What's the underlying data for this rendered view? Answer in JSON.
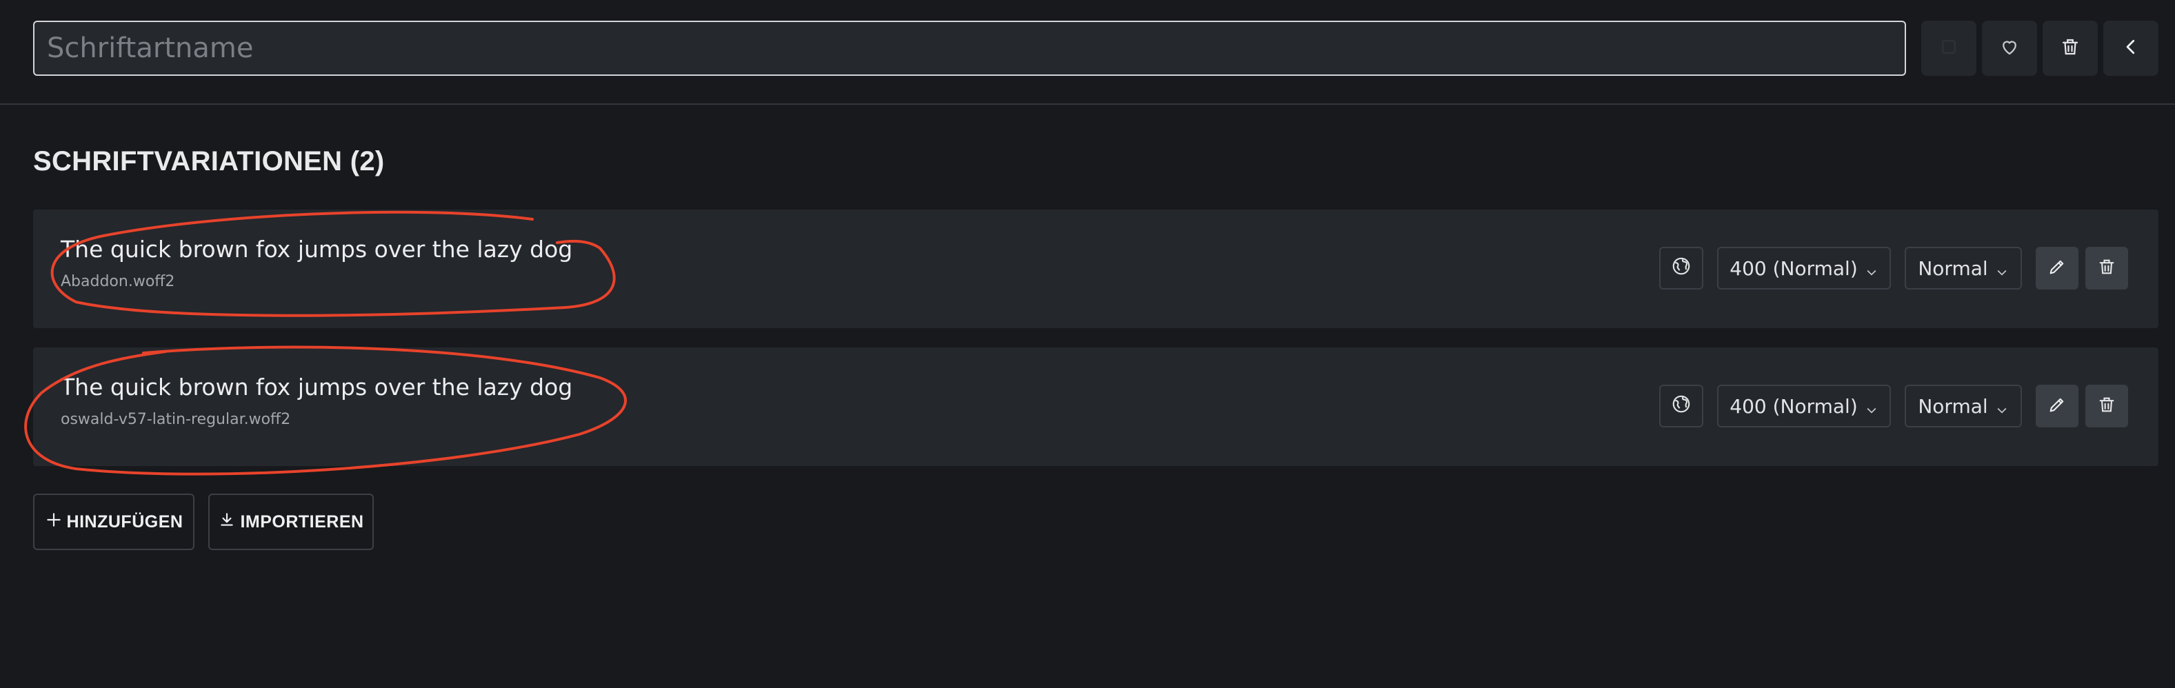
{
  "header": {
    "font_name_placeholder": "Schriftartname",
    "font_name_value": "",
    "icons": [
      "square-icon",
      "heart-icon",
      "trash-icon",
      "chevron-left-icon"
    ]
  },
  "variations": {
    "title": "SCHRIFTVARIATIONEN (2)",
    "items": [
      {
        "sample": "The quick brown fox jumps over the lazy dog",
        "filename": "Abaddon.woff2",
        "weight": "400 (Normal)",
        "style": "Normal"
      },
      {
        "sample": "The quick brown fox jumps over the lazy dog",
        "filename": "oswald-v57-latin-regular.woff2",
        "weight": "400 (Normal)",
        "style": "Normal"
      }
    ]
  },
  "actions": {
    "add_label": "HINZUFÜGEN",
    "import_label": "IMPORTIEREN"
  },
  "colors": {
    "background": "#17191c",
    "panel": "#24272c",
    "annotation": "#e8432b"
  }
}
